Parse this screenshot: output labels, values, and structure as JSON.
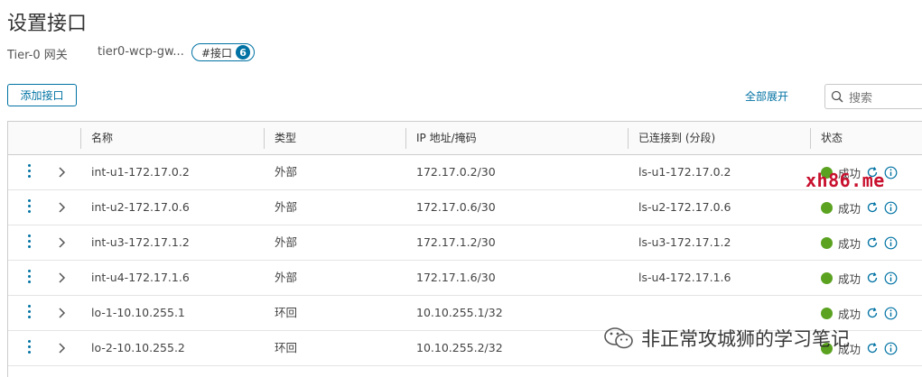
{
  "page": {
    "title": "设置接口",
    "gateway_type": "Tier-0 网关",
    "gateway_name": "tier0-wcp-gw...",
    "interface_tag": "#接口",
    "interface_count": "6"
  },
  "toolbar": {
    "add_label": "添加接口",
    "expand_all_label": "全部展开",
    "search_placeholder": "搜索"
  },
  "table": {
    "headers": {
      "name": "名称",
      "type": "类型",
      "ip": "IP 地址/掩码",
      "connected": "已连接到 (分段)",
      "status": "状态"
    },
    "rows": [
      {
        "name": "int-u1-172.17.0.2",
        "type": "外部",
        "ip": "172.17.0.2/30",
        "connected": "ls-u1-172.17.0.2",
        "status": "成功"
      },
      {
        "name": "int-u2-172.17.0.6",
        "type": "外部",
        "ip": "172.17.0.6/30",
        "connected": "ls-u2-172.17.0.6",
        "status": "成功"
      },
      {
        "name": "int-u3-172.17.1.2",
        "type": "外部",
        "ip": "172.17.1.2/30",
        "connected": "ls-u3-172.17.1.2",
        "status": "成功"
      },
      {
        "name": "int-u4-172.17.1.6",
        "type": "外部",
        "ip": "172.17.1.6/30",
        "connected": "ls-u4-172.17.1.6",
        "status": "成功"
      },
      {
        "name": "lo-1-10.10.255.1",
        "type": "环回",
        "ip": "10.10.255.1/32",
        "connected": "",
        "status": "成功"
      },
      {
        "name": "lo-2-10.10.255.2",
        "type": "环回",
        "ip": "10.10.255.2/32",
        "connected": "",
        "status": "成功"
      }
    ]
  },
  "watermarks": {
    "site": "xh86.me",
    "account": "非正常攻城狮的学习笔记"
  },
  "colors": {
    "accent": "#0072a3",
    "success": "#5aa220",
    "watermark_red": "#c8102e"
  }
}
